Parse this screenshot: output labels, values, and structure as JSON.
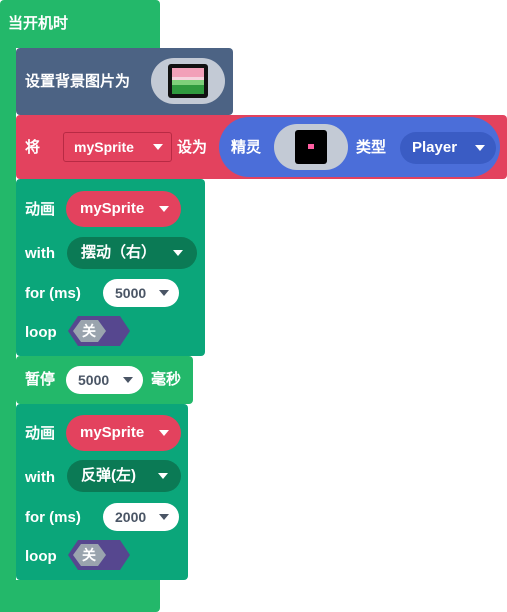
{
  "on_start": {
    "label": "当开机时"
  },
  "set_background": {
    "label": "设置背景图片为",
    "image_icon": "landscape-thumbnail-icon"
  },
  "set_var": {
    "label_set": "将",
    "variable": "mySprite",
    "label_to": "设为",
    "sprite_block": {
      "label": "精灵",
      "image_icon": "sprite-thumbnail-icon",
      "kind_label": "类型",
      "kind": "Player"
    }
  },
  "animate_1": {
    "label_anim": "动画",
    "sprite": "mySprite",
    "label_with": "with",
    "animation": "摆动（右）",
    "label_for": "for (ms)",
    "duration": "5000",
    "label_loop": "loop",
    "loop_value": "关"
  },
  "pause": {
    "label": "暂停",
    "value": "5000",
    "unit": "毫秒"
  },
  "animate_2": {
    "label_anim": "动画",
    "sprite": "mySprite",
    "label_with": "with",
    "animation": "反弹(左)",
    "label_for": "for (ms)",
    "duration": "2000",
    "label_loop": "loop",
    "loop_value": "关"
  },
  "colors": {
    "event_green": "#23b86a",
    "scene_slate": "#4c6384",
    "variables_red": "#e3425e",
    "sprites_blue": "#4b6ed9",
    "animation_green": "#0ba67a",
    "toggle_purple": "#56478f"
  }
}
